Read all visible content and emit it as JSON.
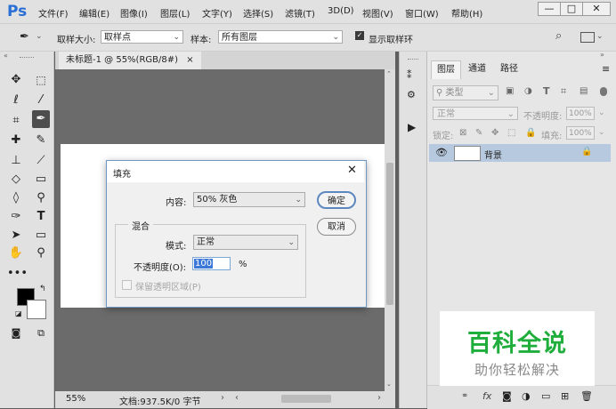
{
  "app": {
    "logo": "Ps"
  },
  "menu": [
    "文件(F)",
    "编辑(E)",
    "图像(I)",
    "图层(L)",
    "文字(Y)",
    "选择(S)",
    "滤镜(T)",
    "3D(D)",
    "视图(V)",
    "窗口(W)",
    "帮助(H)"
  ],
  "window_controls": {
    "minimize": "—",
    "maximize": "□",
    "close": "✕"
  },
  "options_bar": {
    "sample_size_label": "取样大小:",
    "sample_size_value": "取样点",
    "sample_label": "样本:",
    "sample_value": "所有图层",
    "show_ring_label": "显示取样环"
  },
  "document": {
    "tab_title": "未标题-1 @ 55%(RGB/8#)",
    "tab_close": "×",
    "zoom": "55%",
    "doc_info": "文档:937.5K/0 字节"
  },
  "fill_dialog": {
    "title": "填充",
    "close": "✕",
    "content_label": "内容:",
    "content_value": "50% 灰色",
    "blend_group": "混合",
    "mode_label": "模式:",
    "mode_value": "正常",
    "opacity_label": "不透明度(O):",
    "opacity_value": "100",
    "opacity_unit": "%",
    "preserve_label": "保留透明区域(P)",
    "ok_label": "确定",
    "cancel_label": "取消"
  },
  "layers_panel": {
    "tabs": [
      "图层",
      "通道",
      "路径"
    ],
    "filter_label": "类型",
    "blend_mode": "正常",
    "opacity_label": "不透明度:",
    "opacity_value": "100%",
    "lock_label": "锁定:",
    "fill_label": "填充:",
    "fill_value": "100%",
    "layer_name": "背景",
    "bottom_fx": "fx"
  },
  "watermark": {
    "title": "百科全说",
    "subtitle": "助你轻松解决"
  },
  "colors": {
    "accent": "#2a6fd6",
    "watermark_green": "#1fae3c",
    "dialog_border": "#6f97c5",
    "selected_layer": "#b7c9de"
  }
}
